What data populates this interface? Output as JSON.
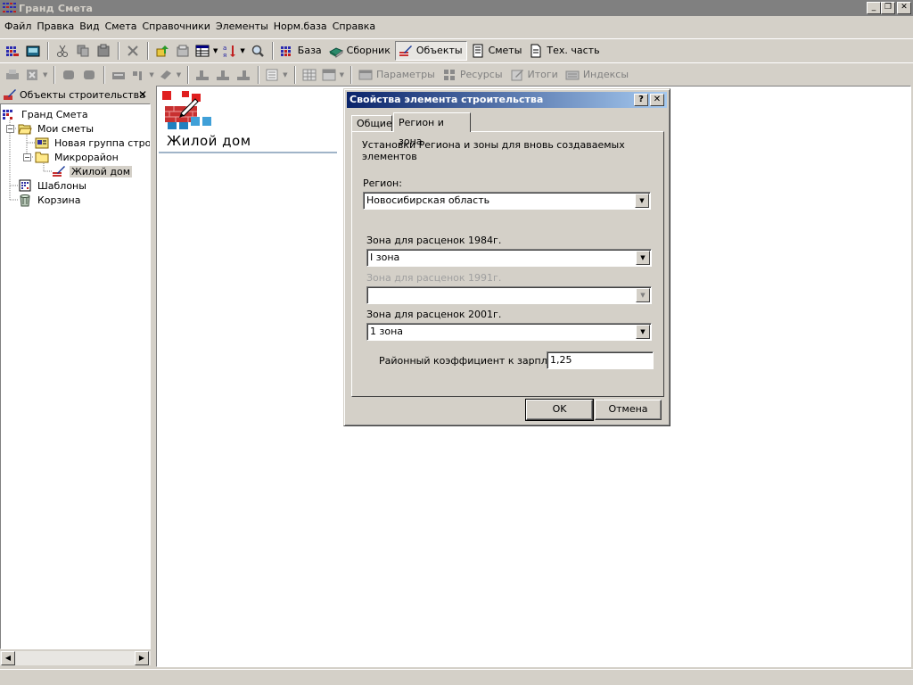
{
  "window": {
    "title": "Гранд Смета"
  },
  "menubar": {
    "items": [
      "Файл",
      "Правка",
      "Вид",
      "Смета",
      "Справочники",
      "Элементы",
      "Норм.база",
      "Справка"
    ]
  },
  "toolbar1": {
    "baza_label": "База",
    "sbornik_label": "Сборник",
    "obekty_label": "Объекты",
    "smety_label": "Сметы",
    "tech_label": "Тех. часть"
  },
  "toolbar2": {
    "parametry_label": "Параметры",
    "resursy_label": "Ресурсы",
    "itogi_label": "Итоги",
    "indeksy_label": "Индексы"
  },
  "left_panel": {
    "title": "Объекты строительства",
    "tree": [
      {
        "label": "Гранд Смета"
      },
      {
        "label": "Мои сметы"
      },
      {
        "label": "Новая группа строек"
      },
      {
        "label": "Микрорайон"
      },
      {
        "label": "Жилой дом"
      },
      {
        "label": "Шаблоны"
      },
      {
        "label": "Корзина"
      }
    ]
  },
  "main": {
    "object_title": "Жилой дом"
  },
  "dialog": {
    "title": "Свойства элемента строительства",
    "help_btn": "?",
    "close_btn": "✕",
    "tabs": [
      "Общие",
      "Регион и зона"
    ],
    "heading": "Установки Региона и зоны для вновь создаваемых элементов",
    "region_label": "Регион:",
    "region_value": "Новосибирская область",
    "zone1984_label": "Зона для расценок 1984г.",
    "zone1984_value": "I зона",
    "zone1991_label": "Зона для расценок 1991г.",
    "zone1991_value": "",
    "zone2001_label": "Зона для расценок 2001г.",
    "zone2001_value": "1 зона",
    "coef_label": "Районный коэффициент к зарплате:",
    "coef_value": "1,25",
    "ok_label": "OK",
    "cancel_label": "Отмена"
  },
  "colors": {
    "dialog_title_start": "#0a246a",
    "dialog_title_end": "#a6caf0",
    "face": "#d4d0c8"
  },
  "icons": [
    "app-grid-icon",
    "calculator-icon",
    "cut-icon",
    "copy-icon",
    "paste-icon",
    "delete-icon",
    "up-arrow-icon",
    "properties-icon",
    "table-icon",
    "sort-icon",
    "search-icon",
    "base-icon",
    "book-icon",
    "objects-icon",
    "document-icon",
    "page-icon",
    "print-icon",
    "excel-icon",
    "folder-icon",
    "trash-icon"
  ]
}
